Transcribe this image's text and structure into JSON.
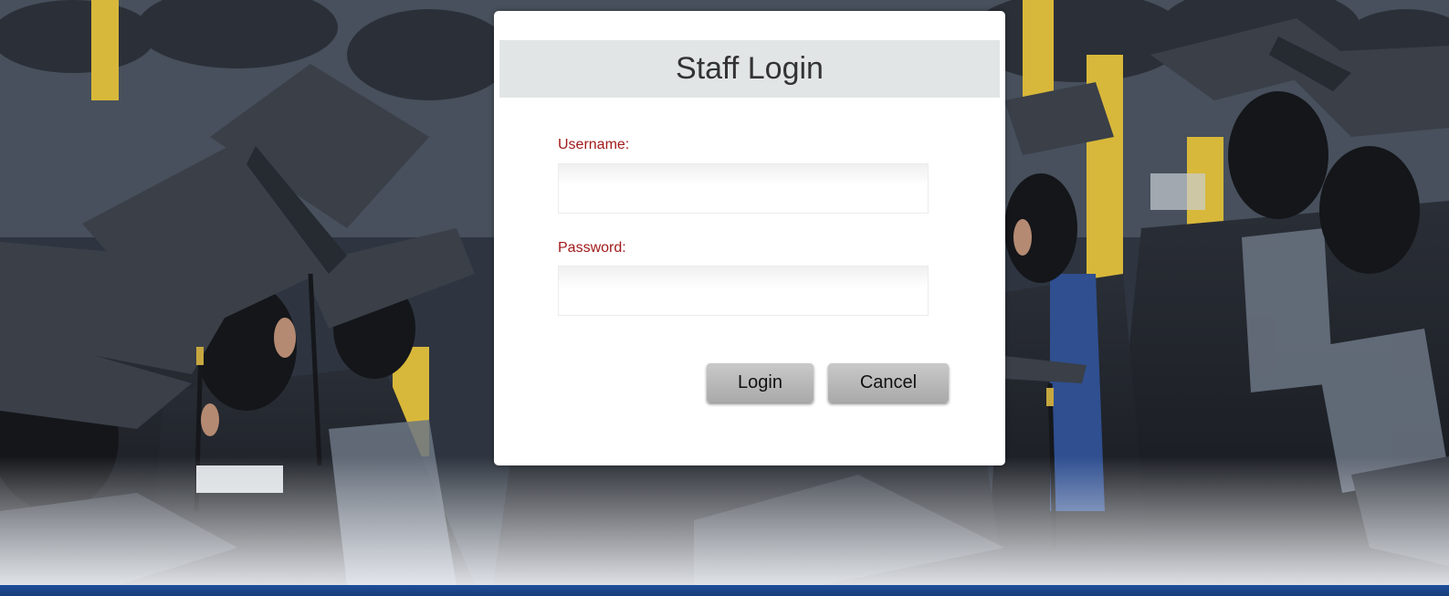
{
  "login": {
    "title": "Staff Login",
    "username_label": "Username:",
    "username_value": "",
    "password_label": "Password:",
    "password_value": "",
    "login_button": "Login",
    "cancel_button": "Cancel"
  },
  "colors": {
    "label_text": "#a11a1a",
    "title_bar": "#e1e5e6",
    "button": "#b9b9b9",
    "footer_bar": "#1f4f9a"
  }
}
